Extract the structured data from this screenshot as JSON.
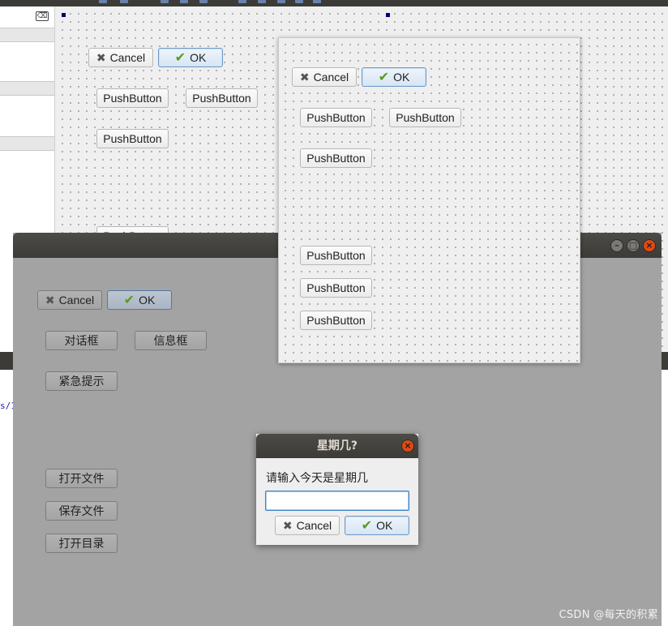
{
  "designer": {
    "clear_icon": "clear-filter-icon",
    "code_fragment": "s/1",
    "form": {
      "cancel_label": "Cancel",
      "ok_label": "OK",
      "push_label": "PushButton",
      "partial_label": "PushButton"
    }
  },
  "main_window": {
    "window_buttons": {
      "minimize": "–",
      "maximize": "□",
      "close": "×"
    },
    "cancel_label": "Cancel",
    "ok_label": "OK",
    "buttons": {
      "dialog": "对话框",
      "info": "信息框",
      "urgent": "紧急提示",
      "open_file": "打开文件",
      "save_file": "保存文件",
      "open_dir": "打开目录"
    }
  },
  "preview_form": {
    "cancel_label": "Cancel",
    "ok_label": "OK",
    "push_label": "PushButton"
  },
  "input_dialog": {
    "title": "星期几?",
    "prompt": "请输入今天是星期几",
    "input_value": "",
    "cancel_label": "Cancel",
    "ok_label": "OK"
  },
  "watermark": "CSDN @每天的积累",
  "colors": {
    "titlebar": "#3c3b37",
    "window_body": "#a3a3a3",
    "close_button": "#df4a16",
    "focus_border": "#3d83c9",
    "ok_check": "#5b9a1c"
  }
}
